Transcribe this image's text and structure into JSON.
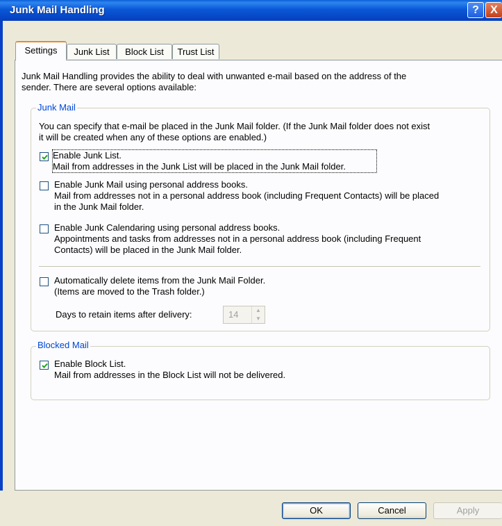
{
  "window": {
    "title": "Junk Mail Handling",
    "help_glyph": "?",
    "close_glyph": "X"
  },
  "tabs": [
    {
      "label": "Settings",
      "active": true
    },
    {
      "label": "Junk List",
      "active": false
    },
    {
      "label": "Block List",
      "active": false
    },
    {
      "label": "Trust List",
      "active": false
    }
  ],
  "intro": {
    "line1": "Junk Mail Handling provides the ability to deal with unwanted e-mail based on the address of the",
    "line2": "sender.  There are several options available:"
  },
  "junk_mail": {
    "title": "Junk Mail",
    "desc_line1": "You can specify that e-mail be placed in the Junk Mail folder.  (If the Junk Mail folder does not exist",
    "desc_line2": "it will be created when any of these options are enabled.)",
    "options": [
      {
        "label": "Enable Junk List.",
        "checked": true,
        "lines": [
          "Mail from addresses in the Junk List will be placed in the Junk Mail folder."
        ]
      },
      {
        "label": "Enable Junk Mail using personal address books.",
        "checked": false,
        "lines": [
          "Mail from addresses not in a personal address book (including Frequent Contacts) will be placed",
          "in the Junk Mail folder."
        ]
      },
      {
        "label": "Enable Junk Calendaring using personal address books.",
        "checked": false,
        "lines": [
          "Appointments and tasks from addresses not in a personal address book (including Frequent",
          "Contacts) will be placed in the Junk Mail folder."
        ]
      }
    ],
    "auto_delete": {
      "label": "Automatically delete items from the Junk Mail Folder.",
      "checked": false,
      "note": "(Items are moved to the Trash folder.)"
    },
    "retain": {
      "label": "Days to retain items after delivery:",
      "value": "14"
    }
  },
  "blocked_mail": {
    "title": "Blocked Mail",
    "label": "Enable Block List.",
    "checked": true,
    "note": "Mail from addresses in the Block List will not be delivered."
  },
  "buttons": {
    "ok": "OK",
    "cancel": "Cancel",
    "apply": "Apply"
  },
  "colors": {
    "titlebar": "#0a58d6",
    "group_title": "#0046d5",
    "tab_highlight": "#e68b2c"
  }
}
